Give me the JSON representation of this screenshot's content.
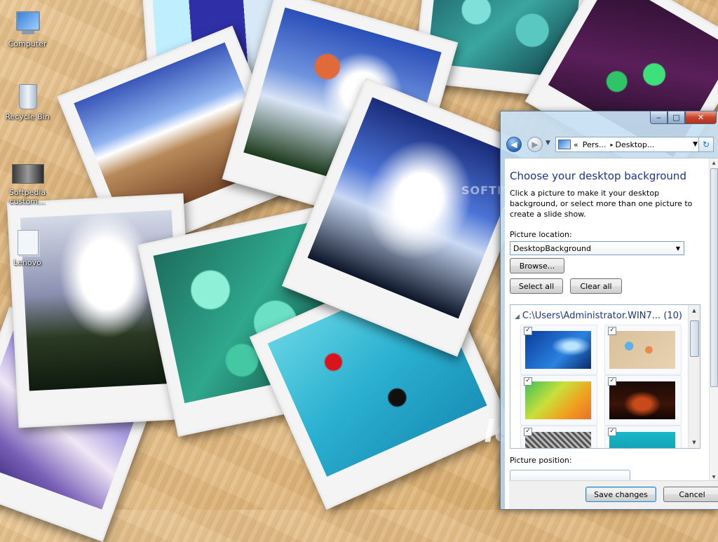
{
  "desktop": {
    "icons": [
      {
        "label": "Computer",
        "icon": "computer-icon"
      },
      {
        "label": "Recycle Bin",
        "icon": "recycle-bin-icon"
      },
      {
        "label": "Softpedia custom...",
        "icon": "image-file-icon"
      },
      {
        "label": "Lenovo",
        "icon": "shortcut-icon"
      }
    ],
    "watermark": "SOFTPEDIA",
    "wallpaper_text": "le"
  },
  "window": {
    "controls": {
      "minimize": "‒",
      "maximize": "□",
      "close": "✕"
    },
    "address": {
      "overflow": "«",
      "crumbs": [
        "Pers...",
        "Desktop..."
      ],
      "separator": "▸"
    },
    "heading": "Choose your desktop background",
    "description": "Click a picture to make it your desktop background, or select more than one picture to create a slide show.",
    "picture_location": {
      "label": "Picture location:",
      "value": "DesktopBackground"
    },
    "buttons": {
      "browse": "Browse...",
      "select_all": "Select all",
      "clear_all": "Clear all",
      "save": "Save changes",
      "cancel": "Cancel"
    },
    "gallery": {
      "group_title": "C:\\Users\\Administrator.WIN7... (10)",
      "thumbnails": [
        {
          "checked": "✓",
          "style": "lv1"
        },
        {
          "checked": "✓",
          "style": "lv2"
        },
        {
          "checked": "✓",
          "style": "lv3"
        },
        {
          "checked": "✓",
          "style": "lv4"
        },
        {
          "checked": "✓",
          "style": "lv5"
        },
        {
          "checked": "✓",
          "style": "lv6"
        }
      ]
    },
    "picture_position": {
      "label": "Picture position:"
    }
  },
  "colors": {
    "heading": "#1e3287",
    "close_button": "#c8452c",
    "wood": "#e3bd86"
  }
}
